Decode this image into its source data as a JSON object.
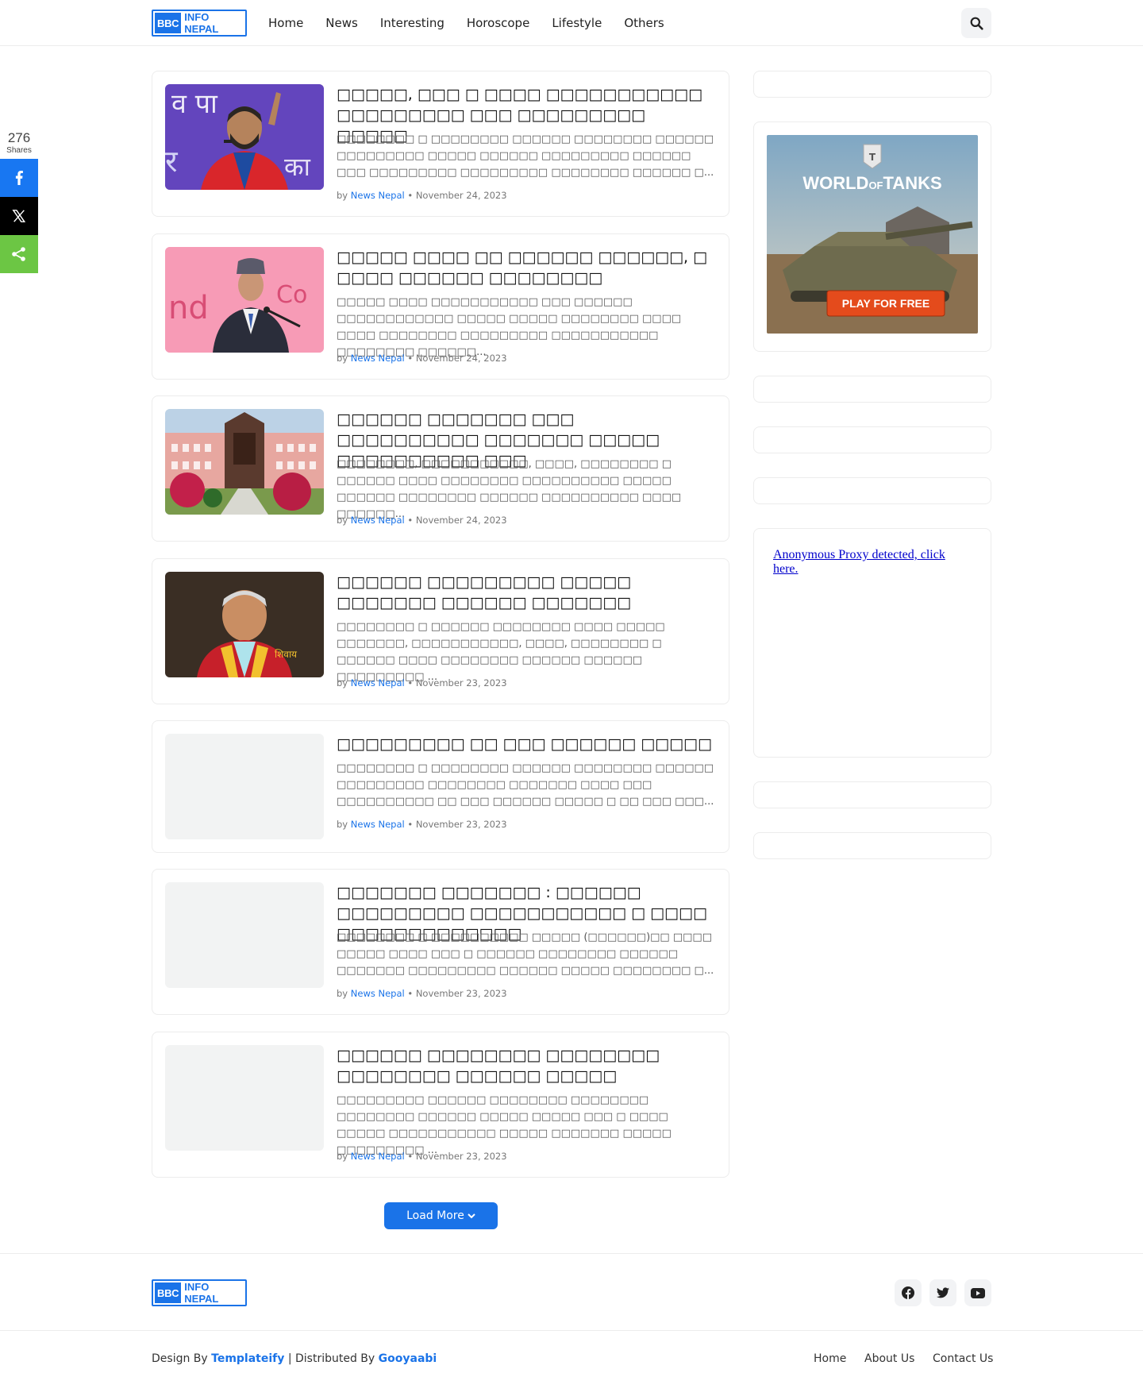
{
  "header": {
    "logo": {
      "bbc": "BBC",
      "text": "INFO NEPAL"
    },
    "nav": [
      "Home",
      "News",
      "Interesting",
      "Horoscope",
      "Lifestyle",
      "Others"
    ],
    "search_icon": "search-icon"
  },
  "share_bar": {
    "count": "276",
    "label": "Shares",
    "buttons": [
      "facebook-icon",
      "x-icon",
      "share-icon"
    ]
  },
  "posts": [
    {
      "title": "□□□□□, □□□ □ □□□□ □□□□□□□□□□□ □□□□□□□□□ □□□ □□□□□□□□□ □□□□□",
      "snippet": "□□□□□□□□ □ □□□□□□□□ □□□□□□ □□□□□□□□ □□□□□□ □□□□□□□□□ □□□□□ □□□□□□ □□□□□□□□□ □□□□□□ □□□ □□□□□□□□□ □□□□□□□□□ □□□□□□□□ □□□□□□ □...",
      "author": "News Nepal",
      "date": "November 24, 2023",
      "has_image": true
    },
    {
      "title": "□□□□□ □□□□ □□ □□□□□□ □□□□□□, □ □□□□ □□□□□□ □□□□□□□□",
      "snippet": "□□□□□ □□□□ □□□□□□□□□□□ □□□ □□□□□□ □□□□□□□□□□□□ □□□□□ □□□□□ □□□□□□□□ □□□□ □□□□ □□□□□□□□ □□□□□□□□□ □□□□□□□□□□□ □□□□□□□□ □□□□□□...",
      "author": "News Nepal",
      "date": "November 24, 2023",
      "has_image": true
    },
    {
      "title": "□□□□□□ □□□□□□□ □□□ □□□□□□□□□□ □□□□□□□ □□□□□ □□□□□□□□□□ □□□",
      "snippet": "□□□□□□□□, □□□□□□□□□□□, □□□□, □□□□□□□□ □ □□□□□□ □□□□ □□□□□□□□ □□□□□□□□□□ □□□□□ □□□□□□ □□□□□□□□ □□□□□□ □□□□□□□□□□ □□□□ □□□□□□...",
      "author": "News Nepal",
      "date": "November 24, 2023",
      "has_image": true
    },
    {
      "title": "□□□□□□ □□□□□□□□□ □□□□□ □□□□□□□ □□□□□□ □□□□□□□",
      "snippet": "□□□□□□□□ □ □□□□□□ □□□□□□□□ □□□□ □□□□□ □□□□□□□, □□□□□□□□□□□, □□□□, □□□□□□□□ □ □□□□□□ □□□□ □□□□□□□□ □□□□□□ □□□□□□ □□□□□□□□□ ...",
      "author": "News Nepal",
      "date": "November 23, 2023",
      "has_image": true
    },
    {
      "title": "□□□□□□□□□ □□ □□□ □□□□□□ □□□□□",
      "snippet": "□□□□□□□□ □ □□□□□□□□ □□□□□□ □□□□□□□□ □□□□□□ □□□□□□□□□ □□□□□□□□ □□□□□□□ □□□□ □□□ □□□□□□□□□□ □□ □□□ □□□□□□ □□□□□ □ □□ □□□ □□□...",
      "author": "News Nepal",
      "date": "November 23, 2023",
      "has_image": false
    },
    {
      "title": "□□□□□□□ □□□□□□□ : □□□□□□ □□□□□□□□□ □□□□□□□□□□□ □ □□□□ □□□□□□□□□□□□□",
      "snippet": "□□□□□□□□ □ □□□□□□□□□□ □□□□□ (□□□□□□)□□ □□□□ □□□□□ □□□□ □□□ □ □□□□□□ □□□□□□□□ □□□□□□ □□□□□□□ □□□□□□□□□ □□□□□□ □□□□□ □□□□□□□□ □...",
      "author": "News Nepal",
      "date": "November 23, 2023",
      "has_image": false
    },
    {
      "title": "□□□□□□ □□□□□□□□ □□□□□□□□ □□□□□□□□ □□□□□□ □□□□□",
      "snippet": "□□□□□□□□□ □□□□□□ □□□□□□□□ □□□□□□□□ □□□□□□□□ □□□□□□ □□□□□ □□□□□ □□□ □ □□□□ □□□□□ □□□□□□□□□□□ □□□□□ □□□□□□□ □□□□□ □□□□□□□□□ ...",
      "author": "News Nepal",
      "date": "November 23, 2023",
      "has_image": false
    }
  ],
  "meta_by": "by",
  "meta_sep": "•",
  "load_more": "Load More",
  "sidebar": {
    "ad": {
      "brand_top": "WORLD",
      "brand_of": "OF",
      "brand_bottom": "TANKS",
      "cta": "PLAY FOR FREE"
    },
    "proxy_text": "Anonymous Proxy detected, click here."
  },
  "footer": {
    "design_by": "Design By",
    "templateify": "Templateify",
    "distributed_by": "| Distributed By",
    "gooyaabi": "Gooyaabi",
    "links": [
      "Home",
      "About Us",
      "Contact Us"
    ],
    "social": [
      "facebook-icon",
      "twitter-icon",
      "youtube-icon"
    ]
  },
  "colors": {
    "accent": "#1a73e8",
    "facebook": "#1877f2",
    "x": "#000000",
    "share": "#6cc644"
  }
}
